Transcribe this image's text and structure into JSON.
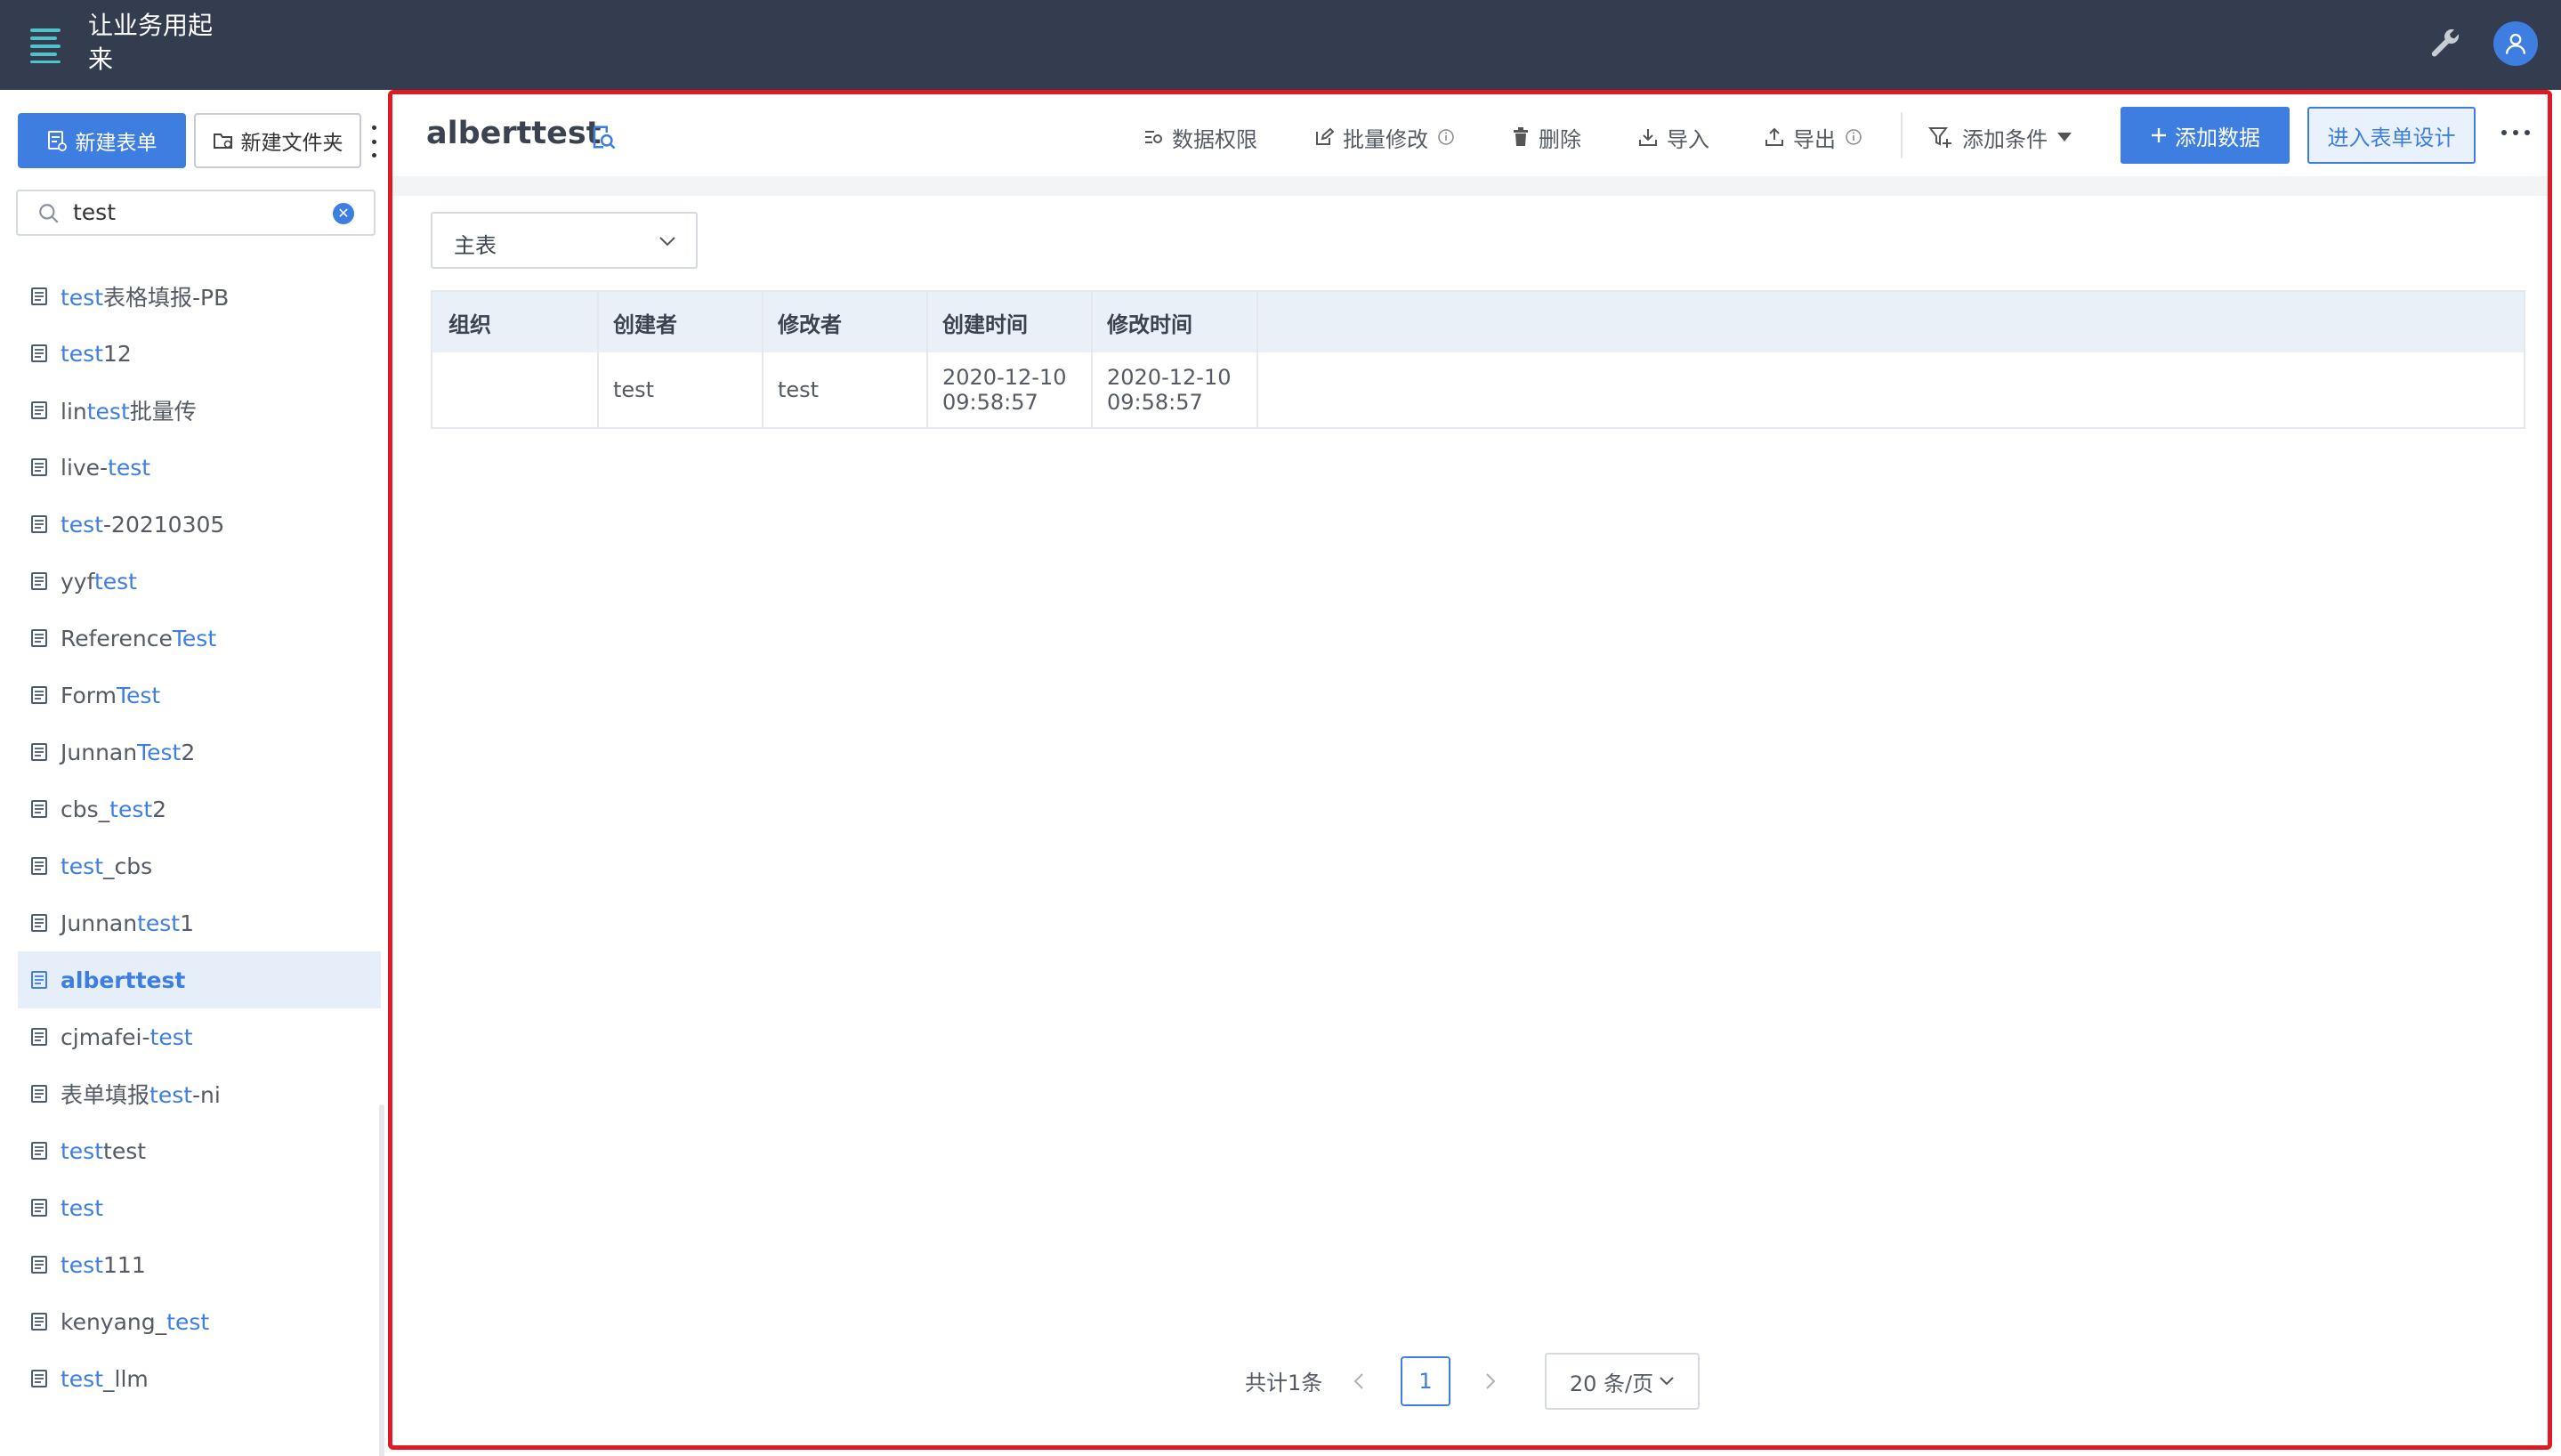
{
  "app": {
    "title": "让业务用起来"
  },
  "sidebar": {
    "new_form_label": "新建表单",
    "new_folder_label": "新建文件夹",
    "search_value": "test",
    "items": [
      {
        "parts": [
          {
            "t": "test",
            "hl": true
          },
          {
            "t": "表格填报-PB",
            "hl": false
          }
        ]
      },
      {
        "parts": [
          {
            "t": "test",
            "hl": true
          },
          {
            "t": "12",
            "hl": false
          }
        ]
      },
      {
        "parts": [
          {
            "t": "lin",
            "hl": false
          },
          {
            "t": "test",
            "hl": true
          },
          {
            "t": "批量传",
            "hl": false
          }
        ]
      },
      {
        "parts": [
          {
            "t": "live-",
            "hl": false
          },
          {
            "t": "test",
            "hl": true
          }
        ]
      },
      {
        "parts": [
          {
            "t": "test",
            "hl": true
          },
          {
            "t": "-20210305",
            "hl": false
          }
        ]
      },
      {
        "parts": [
          {
            "t": "yyf",
            "hl": false
          },
          {
            "t": "test",
            "hl": true
          }
        ]
      },
      {
        "parts": [
          {
            "t": "Reference",
            "hl": false
          },
          {
            "t": "Test",
            "hl": true
          }
        ]
      },
      {
        "parts": [
          {
            "t": "Form",
            "hl": false
          },
          {
            "t": "Test",
            "hl": true
          }
        ]
      },
      {
        "parts": [
          {
            "t": "Junnan",
            "hl": false
          },
          {
            "t": "Test",
            "hl": true
          },
          {
            "t": "2",
            "hl": false
          }
        ]
      },
      {
        "parts": [
          {
            "t": "cbs_",
            "hl": false
          },
          {
            "t": "test",
            "hl": true
          },
          {
            "t": "2",
            "hl": false
          }
        ]
      },
      {
        "parts": [
          {
            "t": "test",
            "hl": true
          },
          {
            "t": "_cbs",
            "hl": false
          }
        ]
      },
      {
        "parts": [
          {
            "t": "Junnan",
            "hl": false
          },
          {
            "t": "test",
            "hl": true
          },
          {
            "t": "1",
            "hl": false
          }
        ]
      },
      {
        "parts": [
          {
            "t": "alberttest",
            "hl": false
          }
        ],
        "active": true
      },
      {
        "parts": [
          {
            "t": "cjmafei-",
            "hl": false
          },
          {
            "t": "test",
            "hl": true
          }
        ]
      },
      {
        "parts": [
          {
            "t": "表单填报",
            "hl": false
          },
          {
            "t": "test",
            "hl": true
          },
          {
            "t": "-ni",
            "hl": false
          }
        ]
      },
      {
        "parts": [
          {
            "t": "test",
            "hl": true
          },
          {
            "t": "test",
            "hl": false
          }
        ]
      },
      {
        "parts": [
          {
            "t": "test",
            "hl": true
          }
        ]
      },
      {
        "parts": [
          {
            "t": "test",
            "hl": true
          },
          {
            "t": "111",
            "hl": false
          }
        ]
      },
      {
        "parts": [
          {
            "t": "kenyang_",
            "hl": false
          },
          {
            "t": "test",
            "hl": true
          }
        ]
      },
      {
        "parts": [
          {
            "t": "test",
            "hl": true
          },
          {
            "t": "_llm",
            "hl": false
          }
        ]
      }
    ]
  },
  "main": {
    "title": "alberttest",
    "toolbar": {
      "data_permission": "数据权限",
      "batch_edit": "批量修改",
      "delete": "删除",
      "import": "导入",
      "export": "导出",
      "add_condition": "添加条件",
      "add_data": "添加数据",
      "enter_design": "进入表单设计"
    },
    "table_select": "主表",
    "table": {
      "columns": [
        "组织",
        "创建者",
        "修改者",
        "创建时间",
        "修改时间",
        ""
      ],
      "rows": [
        [
          "",
          "test",
          "test",
          "2020-12-10 09:58:57",
          "2020-12-10 09:58:57",
          ""
        ]
      ]
    },
    "pagination": {
      "total": "共计1条",
      "current_page": "1",
      "page_size": "20 条/页"
    }
  },
  "colors": {
    "topbar": "#343c4f",
    "accent": "#3d7ee0",
    "highlight_border": "#e01a22"
  }
}
